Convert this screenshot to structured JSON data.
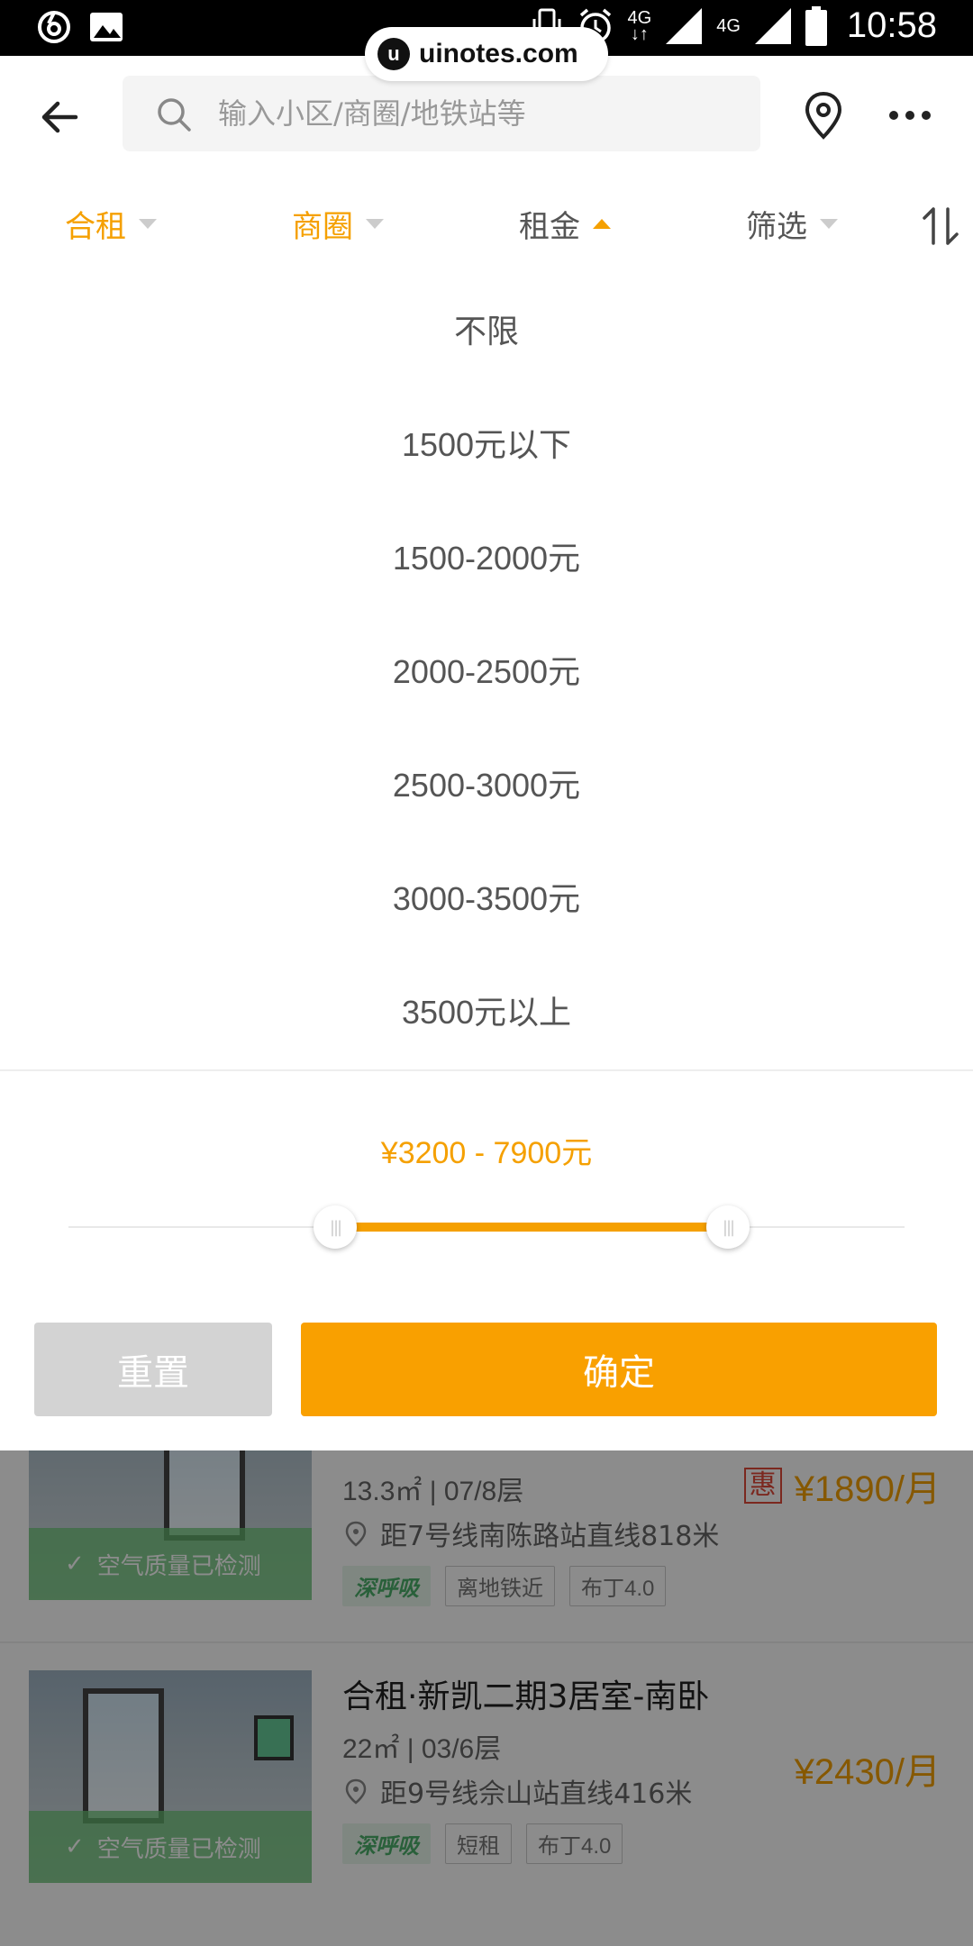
{
  "status_bar": {
    "time": "10:58",
    "network_1": "4G",
    "network_2": "4G",
    "icons": [
      "netease-icon",
      "gallery-icon",
      "vibrate-icon",
      "alarm-icon",
      "signal-icon",
      "battery-icon"
    ]
  },
  "watermark": {
    "logo": "u",
    "text": "uinotes.com"
  },
  "search": {
    "placeholder": "输入小区/商圈/地铁站等"
  },
  "filters": [
    {
      "label": "合租",
      "active": true
    },
    {
      "label": "商圈",
      "active": true
    },
    {
      "label": "租金",
      "active": true,
      "open": true
    },
    {
      "label": "筛选",
      "active": false
    }
  ],
  "rent_options": [
    "不限",
    "1500元以下",
    "1500-2000元",
    "2000-2500元",
    "2500-3000元",
    "3000-3500元",
    "3500元以上"
  ],
  "range": {
    "label": "¥3200 - 7900元",
    "low_fraction": 0.32,
    "high_fraction": 0.79
  },
  "buttons": {
    "reset": "重置",
    "confirm": "确定"
  },
  "listings": [
    {
      "title": "",
      "meta": "13.3㎡ | 07/8层",
      "distance": "距7号线南陈路站直线818米",
      "tags": [
        "深呼吸",
        "离地铁近",
        "布丁4.0"
      ],
      "promo": "惠",
      "price": "¥1890/月",
      "badge": "空气质量已检测"
    },
    {
      "title": "合租·新凯二期3居室-南卧",
      "meta": "22㎡ | 03/6层",
      "distance": "距9号线佘山站直线416米",
      "tags": [
        "深呼吸",
        "短租",
        "布丁4.0"
      ],
      "promo": "",
      "price": "¥2430/月",
      "badge": "空气质量已检测"
    }
  ],
  "colors": {
    "accent": "#f5a000",
    "reset_bg": "#d3d3d3",
    "overlay": "rgba(0,0,0,0.45)"
  }
}
